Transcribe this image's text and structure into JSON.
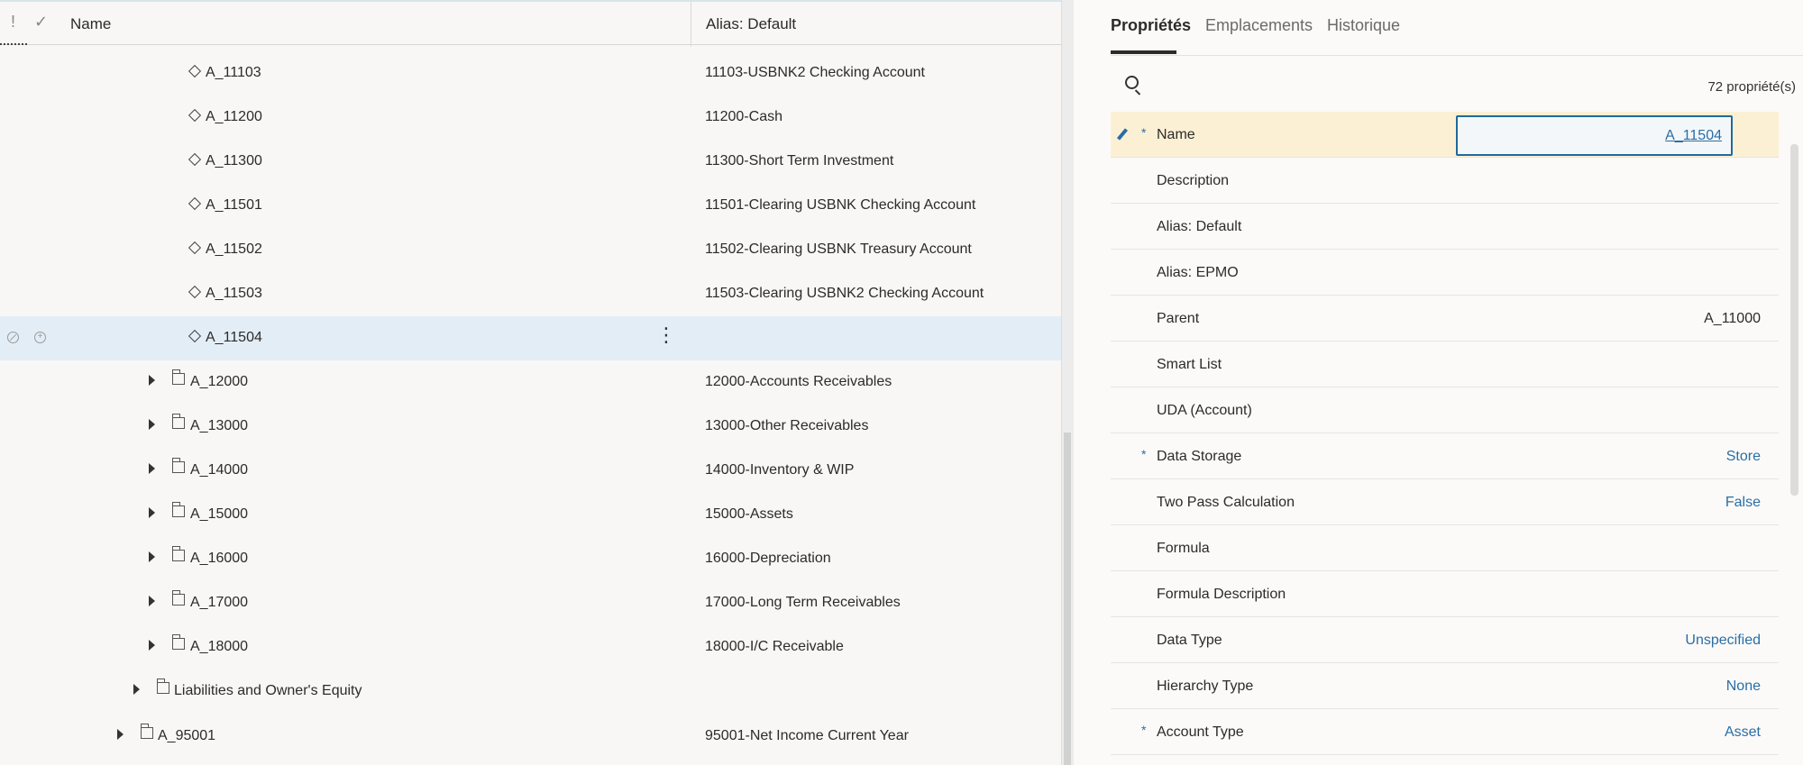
{
  "grid": {
    "header": {
      "excl": "!",
      "check": "✓",
      "name": "Name",
      "alias": "Alias: Default"
    },
    "rows": [
      {
        "label": "A_11103",
        "alias": "11103-USBNK2 Checking Account",
        "icon": "member-diamond-icon"
      },
      {
        "label": "A_11200",
        "alias": "11200-Cash",
        "icon": "member-diamond-icon"
      },
      {
        "label": "A_11300",
        "alias": "11300-Short Term Investment",
        "icon": "member-diamond-icon"
      },
      {
        "label": "A_11501",
        "alias": "11501-Clearing USBNK Checking Account",
        "icon": "member-diamond-icon"
      },
      {
        "label": "A_11502",
        "alias": "11502-Clearing USBNK Treasury Account",
        "icon": "member-diamond-icon"
      },
      {
        "label": "A_11503",
        "alias": "11503-Clearing USBNK2 Checking Account",
        "icon": "member-diamond-icon"
      },
      {
        "label": "A_11504",
        "alias": "",
        "icon": "member-diamond-icon",
        "selected": true,
        "kebab": "⋮"
      },
      {
        "label": "A_12000",
        "alias": "12000-Accounts Receivables",
        "icon": "folder-icon"
      },
      {
        "label": "A_13000",
        "alias": "13000-Other Receivables",
        "icon": "folder-icon"
      },
      {
        "label": "A_14000",
        "alias": "14000-Inventory & WIP",
        "icon": "folder-icon"
      },
      {
        "label": "A_15000",
        "alias": "15000-Assets",
        "icon": "folder-icon"
      },
      {
        "label": "A_16000",
        "alias": "16000-Depreciation",
        "icon": "folder-icon"
      },
      {
        "label": "A_17000",
        "alias": "17000-Long Term Receivables",
        "icon": "folder-icon"
      },
      {
        "label": "A_18000",
        "alias": "18000-I/C Receivable",
        "icon": "folder-icon"
      },
      {
        "label": "Liabilities and Owner's Equity",
        "alias": "",
        "icon": "folder-icon"
      },
      {
        "label": "A_95001",
        "alias": "95001-Net Income Current Year",
        "icon": "folder-icon"
      }
    ]
  },
  "panel": {
    "tabs": [
      "Propriétés",
      "Emplacements",
      "Historique"
    ],
    "active_tab": "Propriétés",
    "count": "72 propriété(s)",
    "name_input_value": "A_11504",
    "properties": [
      {
        "name": "Name",
        "value": "",
        "required": "*",
        "editing": true
      },
      {
        "name": "Description",
        "value": ""
      },
      {
        "name": "Alias: Default",
        "value": ""
      },
      {
        "name": "Alias: EPMO",
        "value": ""
      },
      {
        "name": "Parent",
        "value": "A_11000"
      },
      {
        "name": "Smart List",
        "value": ""
      },
      {
        "name": "UDA (Account)",
        "value": ""
      },
      {
        "name": "Data Storage",
        "value": "Store",
        "required": "*",
        "link": true
      },
      {
        "name": "Two Pass Calculation",
        "value": "False",
        "link": true
      },
      {
        "name": "Formula",
        "value": ""
      },
      {
        "name": "Formula Description",
        "value": ""
      },
      {
        "name": "Data Type",
        "value": "Unspecified",
        "link": true
      },
      {
        "name": "Hierarchy Type",
        "value": "None",
        "link": true
      },
      {
        "name": "Account Type",
        "value": "Asset",
        "required": "*",
        "link": true
      }
    ]
  },
  "colors": {
    "selected_row": "#e3edf6",
    "editing_row": "#fcf0d4",
    "link": "#2a6ea6",
    "input_border": "#1f6a9c"
  }
}
